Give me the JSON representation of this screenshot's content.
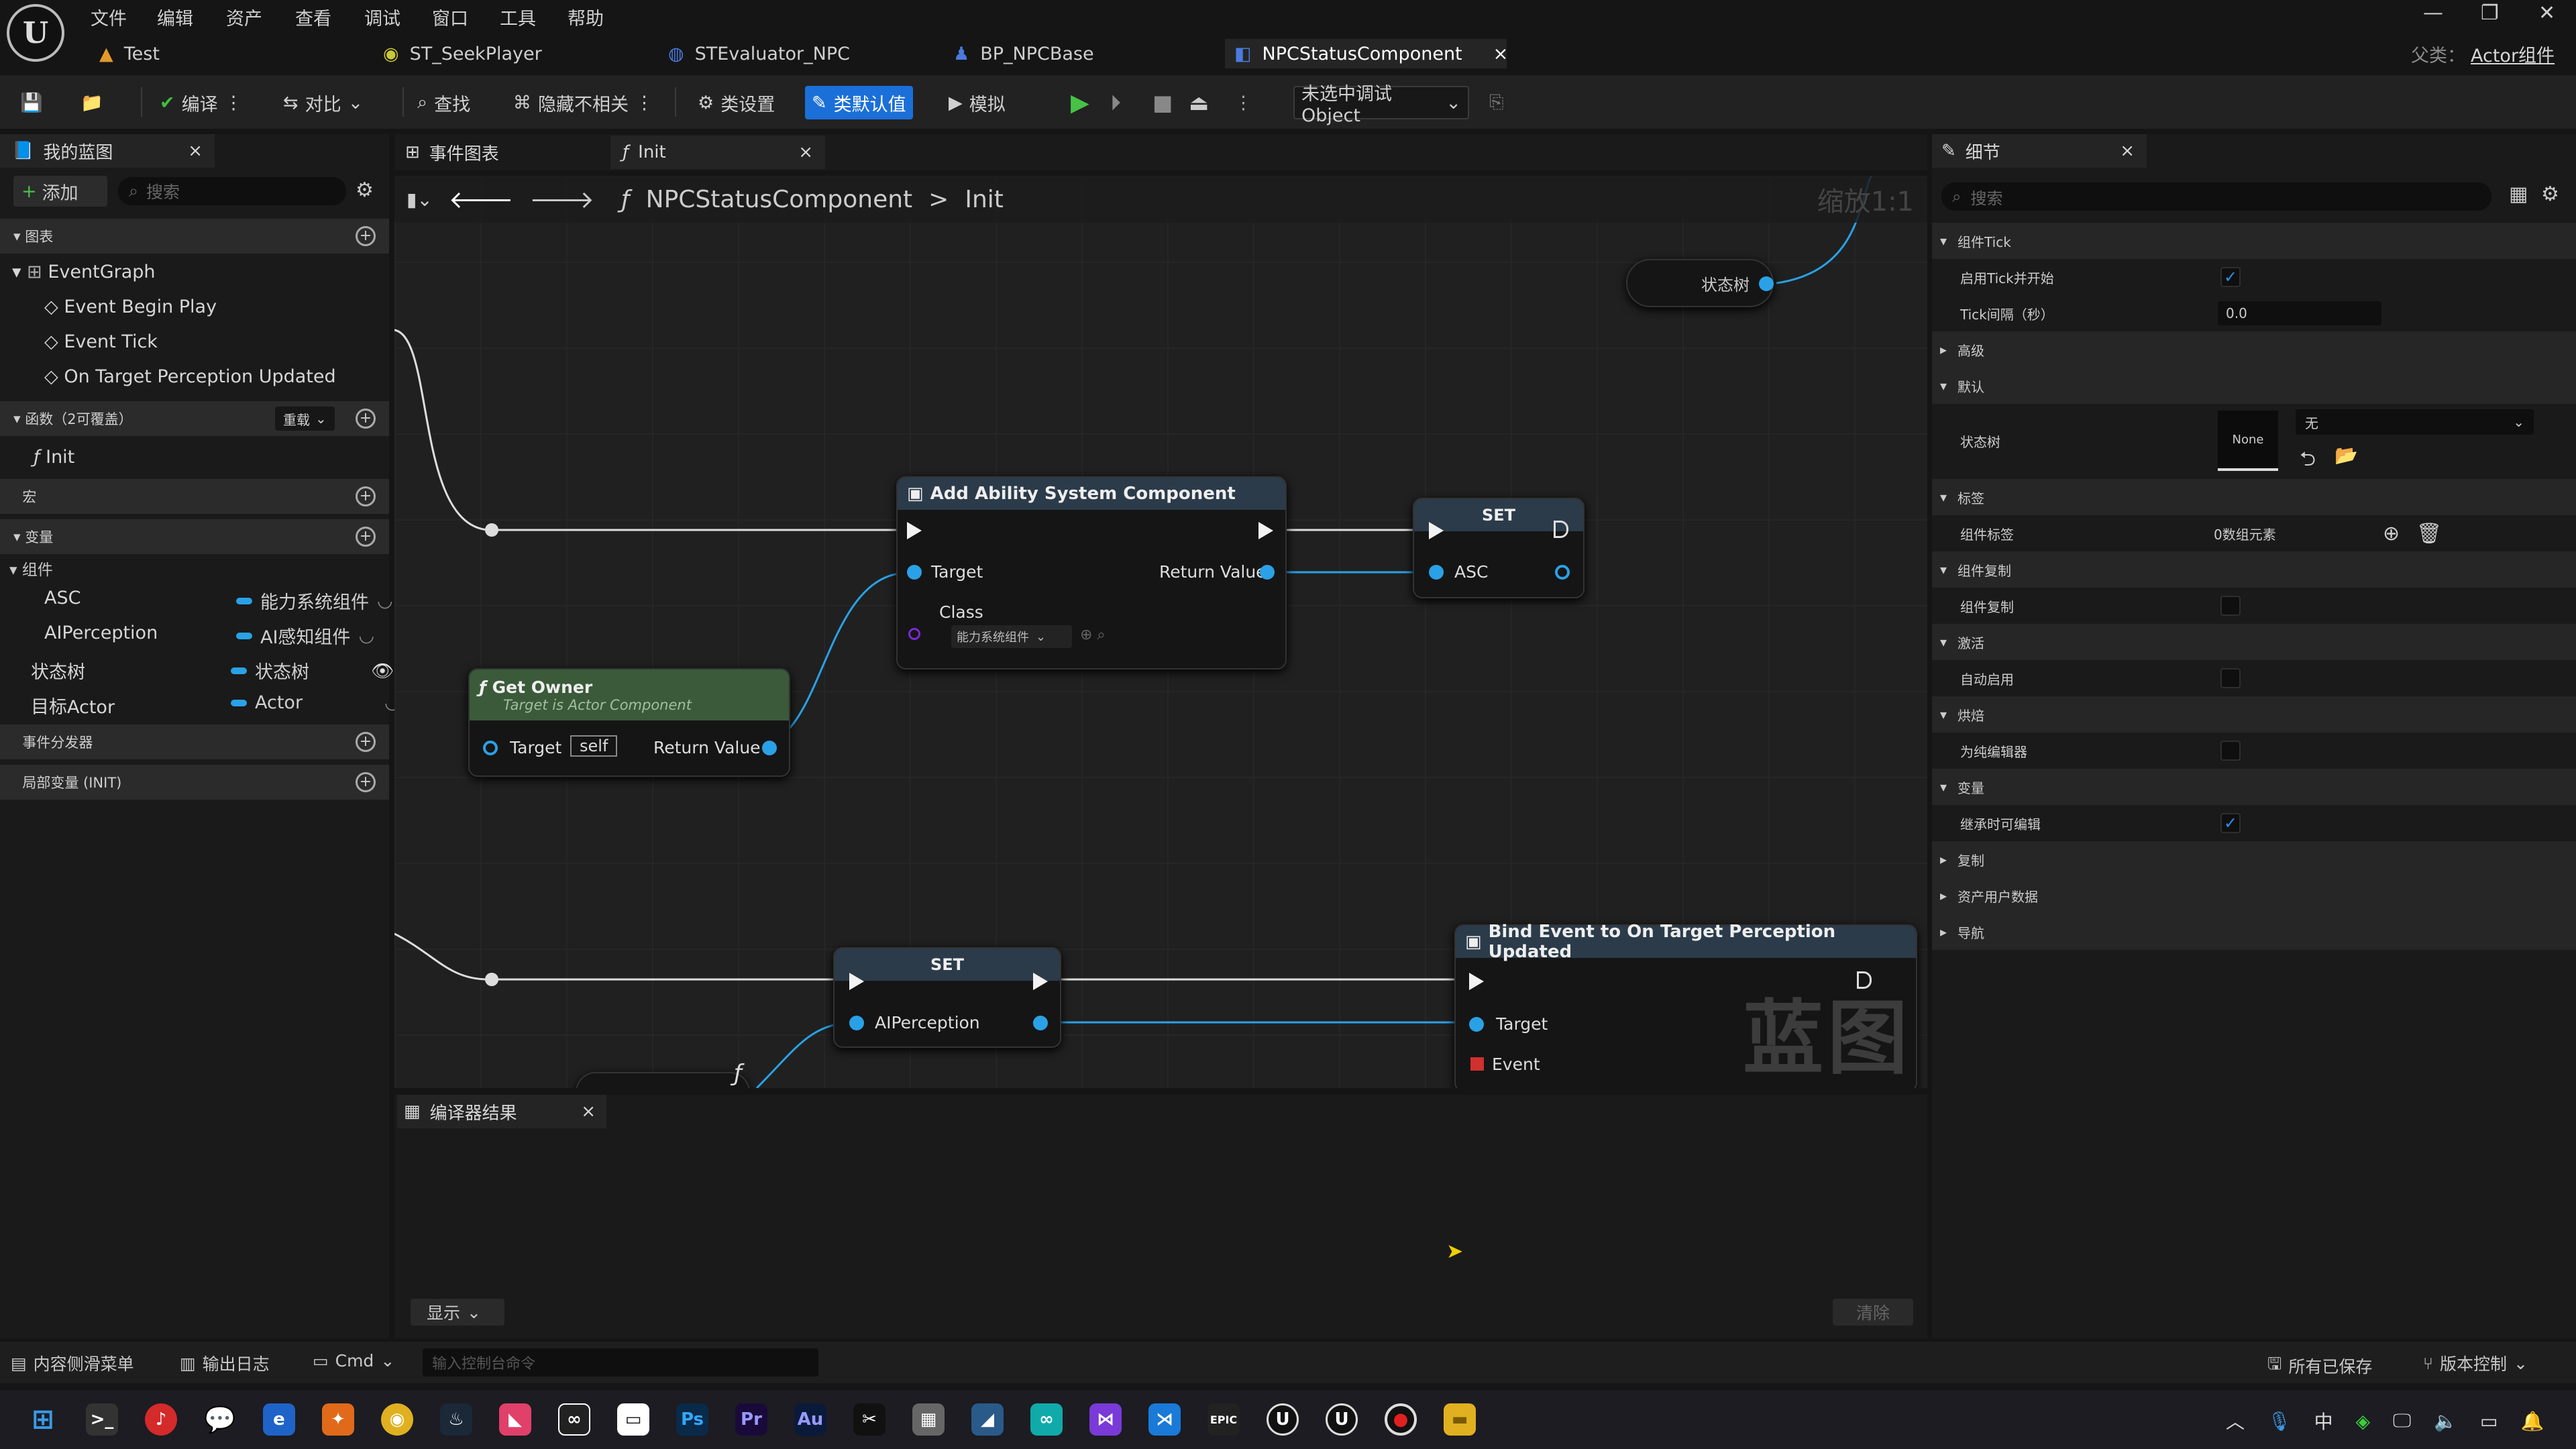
{
  "menu": [
    "文件",
    "编辑",
    "资产",
    "查看",
    "调试",
    "窗口",
    "工具",
    "帮助"
  ],
  "tabs": [
    {
      "label": "Test"
    },
    {
      "label": "ST_SeekPlayer"
    },
    {
      "label": "STEvaluator_NPC"
    },
    {
      "label": "BP_NPCBase"
    },
    {
      "label": "NPCStatusComponent",
      "close": "×"
    }
  ],
  "parent_class": {
    "label": "父类：",
    "value": "Actor组件"
  },
  "toolbar": {
    "compile": "编译",
    "diff": "对比",
    "find": "查找",
    "hide": "隐藏不相关",
    "class_settings": "类设置",
    "class_defaults": "类默认值",
    "simulate": "模拟",
    "debug_object": "未选中调试Object"
  },
  "my_blueprint": {
    "tab": "我的蓝图",
    "add": "添加",
    "search_placeholder": "搜索",
    "graphs_section": "图表",
    "event_graph": "EventGraph",
    "events": [
      "Event Begin Play",
      "Event Tick",
      "On Target Perception Updated"
    ],
    "functions_section": "函数（2可覆盖）",
    "override": "重载",
    "init": "Init",
    "macros_section": "宏",
    "variables_section": "变量",
    "components_group": "组件",
    "variables": [
      {
        "name": "ASC",
        "type": "能力系统组件"
      },
      {
        "name": "AIPerception",
        "type": "AI感知组件"
      },
      {
        "name": "状态树",
        "type": "状态树"
      },
      {
        "name": "目标Actor",
        "type": "Actor"
      }
    ],
    "dispatchers_section": "事件分发器",
    "locals_section": "局部变量 (INIT)"
  },
  "graph": {
    "tab_event": "事件图表",
    "tab_init": "Init",
    "breadcrumb_root": "NPCStatusComponent",
    "breadcrumb_sep": ">",
    "breadcrumb_leaf": "Init",
    "zoom": "缩放1:1",
    "watermark": "蓝图",
    "nodes": {
      "state_tree": "状态树",
      "add_asc": {
        "title": "Add Ability System Component",
        "target": "Target",
        "return": "Return Value",
        "class": "Class",
        "class_value": "能力系统组件"
      },
      "set1": {
        "title": "SET",
        "pin": "ASC"
      },
      "get_owner": {
        "title": "Get Owner",
        "subtitle": "Target is Actor Component",
        "target": "Target",
        "self": "self",
        "return": "Return Value"
      },
      "set2": {
        "title": "SET",
        "pin": "AIPerception"
      },
      "bind": {
        "title": "Bind Event to On Target Perception Updated",
        "target": "Target",
        "event": "Event"
      }
    }
  },
  "compiler": {
    "tab": "编译器结果",
    "show": "显示",
    "clear": "清除"
  },
  "details": {
    "tab": "细节",
    "search_placeholder": "搜索",
    "rows": [
      {
        "kind": "section",
        "label": "组件Tick"
      },
      {
        "kind": "check",
        "label": "启用Tick并开始",
        "checked": true
      },
      {
        "kind": "input",
        "label": "Tick间隔（秒）",
        "value": "0.0"
      },
      {
        "kind": "section-collapsed",
        "label": "高级"
      },
      {
        "kind": "section",
        "label": "默认"
      },
      {
        "kind": "asset",
        "label": "状态树",
        "thumb": "None",
        "value": "无"
      },
      {
        "kind": "section",
        "label": "标签"
      },
      {
        "kind": "array",
        "label": "组件标签",
        "value": "0数组元素"
      },
      {
        "kind": "section",
        "label": "组件复制"
      },
      {
        "kind": "check",
        "label": "组件复制",
        "checked": false
      },
      {
        "kind": "section",
        "label": "激活"
      },
      {
        "kind": "check",
        "label": "自动启用",
        "checked": false
      },
      {
        "kind": "section",
        "label": "烘焙"
      },
      {
        "kind": "check",
        "label": "为纯编辑器",
        "checked": false
      },
      {
        "kind": "section",
        "label": "变量"
      },
      {
        "kind": "check",
        "label": "继承时可编辑",
        "checked": true
      },
      {
        "kind": "section-collapsed",
        "label": "复制"
      },
      {
        "kind": "section-collapsed",
        "label": "资产用户数据"
      },
      {
        "kind": "section-collapsed",
        "label": "导航"
      }
    ]
  },
  "statusbar": {
    "content_drawer": "内容侧滑菜单",
    "output_log": "输出日志",
    "cmd": "Cmd",
    "console_placeholder": "输入控制台命令",
    "all_saved": "所有已保存",
    "source_control": "版本控制"
  },
  "taskbar": {
    "ime": "中"
  },
  "colors": {
    "accent": "#1b6fd8",
    "pin_blue": "#2aa1e6",
    "get_owner_head": "#3a5a3a",
    "func_head": "#2b3b4a",
    "event_red": "#d03030"
  }
}
